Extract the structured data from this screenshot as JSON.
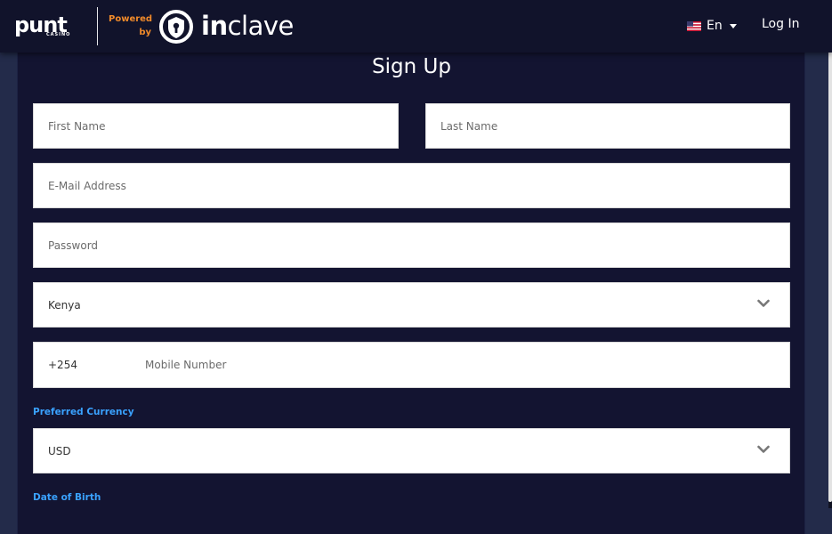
{
  "header": {
    "logo_wordmark": "punt",
    "logo_sub": "CASINO",
    "powered_line1": "Powered",
    "powered_line2": "by",
    "partner_name_bold": "in",
    "partner_name_rest": "clave",
    "language_label": "En",
    "login_label": "Log In"
  },
  "form": {
    "title": "Sign Up",
    "first_name_placeholder": "First Name",
    "last_name_placeholder": "Last Name",
    "email_placeholder": "E-Mail Address",
    "password_placeholder": "Password",
    "country_value": "Kenya",
    "phone_prefix": "+254",
    "mobile_placeholder": "Mobile Number",
    "currency_label": "Preferred Currency",
    "currency_value": "USD",
    "dob_label": "Date of Birth"
  },
  "colors": {
    "header_bg": "#11132b",
    "panel_bg": "#131431",
    "accent_orange": "#f08a2a",
    "label_blue": "#3aa2ff"
  },
  "icons": [
    "punt-logo-icon",
    "inclave-shield-icon",
    "us-flag-icon",
    "caret-down-icon",
    "chevron-down-icon"
  ]
}
